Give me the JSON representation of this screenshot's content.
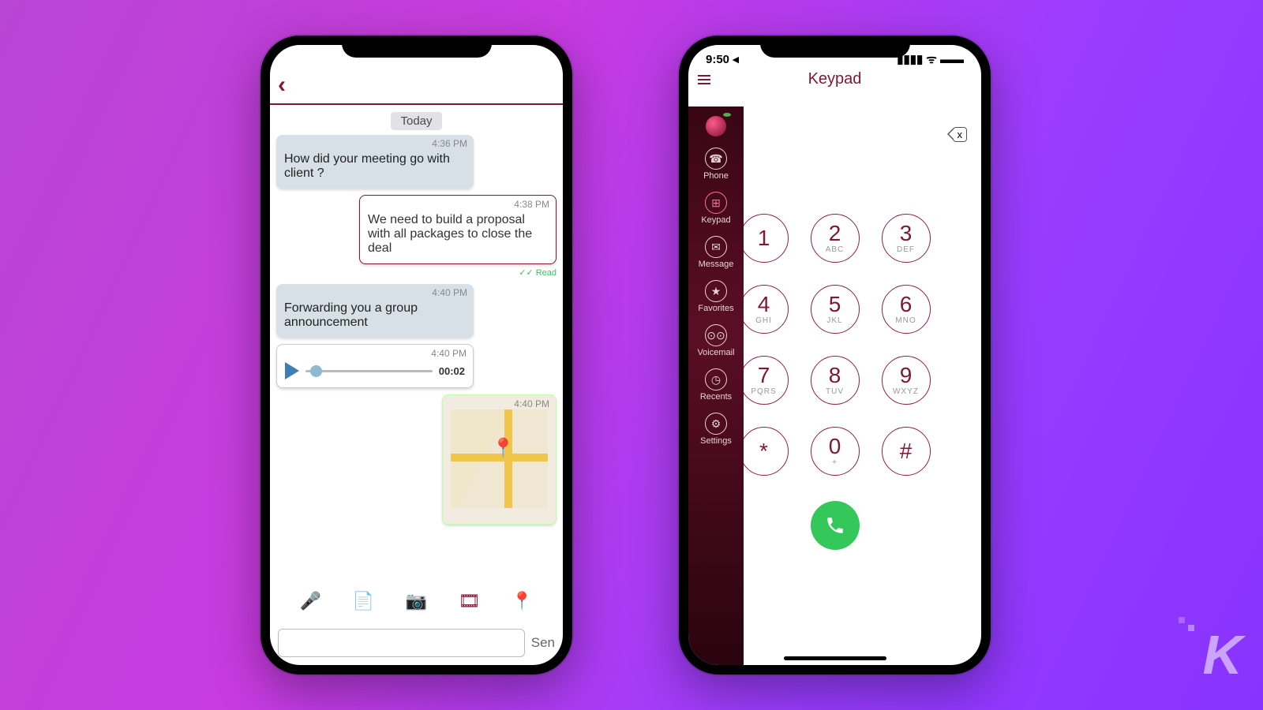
{
  "chat": {
    "day": "Today",
    "msgs": [
      {
        "ts": "4:36 PM",
        "side": "in",
        "text": "How did your meeting go with client ?"
      },
      {
        "ts": "4:38 PM",
        "side": "out",
        "text": "We need to build a proposal with all packages to close the deal",
        "read": "✓✓ Read"
      },
      {
        "ts": "4:40 PM",
        "side": "in",
        "text": "Forwarding you a group announcement"
      },
      {
        "ts": "4:40 PM",
        "side": "in",
        "voice": "00:02"
      },
      {
        "ts": "4:40 PM",
        "side": "out",
        "map": true
      }
    ],
    "compose_placeholder": "",
    "send": "Sen"
  },
  "keypad": {
    "status_time": "9:50",
    "title": "Keypad",
    "backspace": "x",
    "side_items": [
      {
        "label": "Phone"
      },
      {
        "label": "Keypad",
        "active": true
      },
      {
        "label": "Message"
      },
      {
        "label": "Favorites"
      },
      {
        "label": "Voicemail"
      },
      {
        "label": "Recents"
      },
      {
        "label": "Settings"
      }
    ],
    "keys": [
      {
        "d": "1",
        "l": ""
      },
      {
        "d": "2",
        "l": "ABC"
      },
      {
        "d": "3",
        "l": "DEF"
      },
      {
        "d": "4",
        "l": "GHI"
      },
      {
        "d": "5",
        "l": "JKL"
      },
      {
        "d": "6",
        "l": "MNO"
      },
      {
        "d": "7",
        "l": "PQRS"
      },
      {
        "d": "8",
        "l": "TUV"
      },
      {
        "d": "9",
        "l": "WXYZ"
      },
      {
        "d": "*",
        "l": ""
      },
      {
        "d": "0",
        "l": "+"
      },
      {
        "d": "#",
        "l": ""
      }
    ]
  },
  "watermark": "K",
  "colors": {
    "brand": "#7d1835",
    "call": "#34c759"
  }
}
